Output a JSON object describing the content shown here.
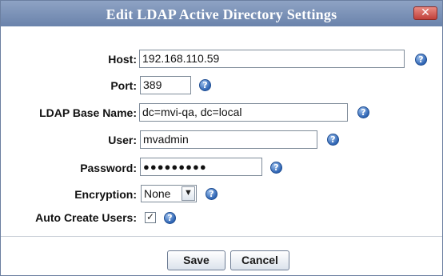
{
  "dialog": {
    "title": "Edit LDAP Active Directory Settings",
    "close_glyph": "✕"
  },
  "form": {
    "host_label": "Host:",
    "host_value": "192.168.110.59",
    "port_label": "Port:",
    "port_value": "389",
    "base_label": "LDAP Base Name:",
    "base_value": "dc=mvi-qa, dc=local",
    "user_label": "User:",
    "user_value": "mvadmin",
    "password_label": "Password:",
    "password_mask": "●●●●●●●●●",
    "encryption_label": "Encryption:",
    "encryption_value": "None",
    "auto_create_label": "Auto Create Users:",
    "auto_create_checked": "✓"
  },
  "help_glyph": "?",
  "buttons": {
    "save": "Save",
    "cancel": "Cancel"
  },
  "icons": {
    "help": "help-icon",
    "close": "close-icon",
    "dropdown": "chevron-down-icon"
  }
}
